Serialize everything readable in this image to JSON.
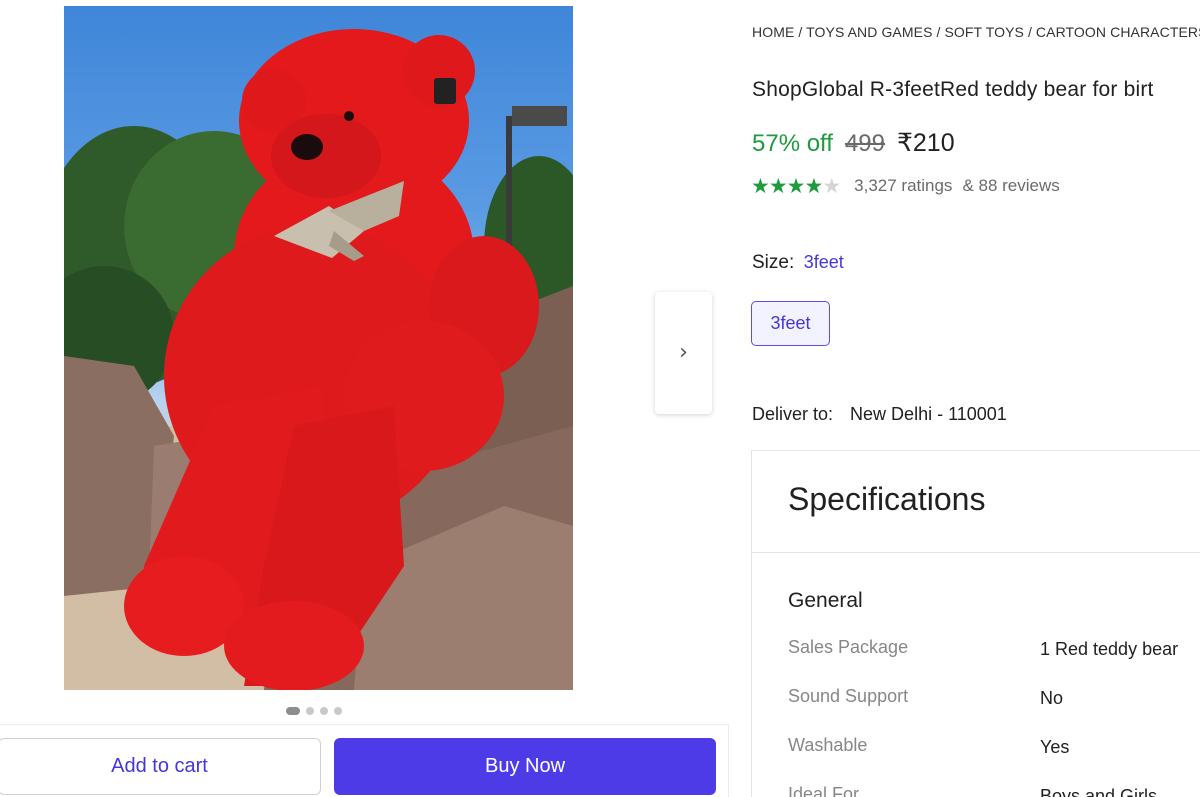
{
  "breadcrumb": "HOME / TOYS AND GAMES / SOFT TOYS / CARTOON CHARACTERS",
  "product": {
    "title": "ShopGlobal R-3feetRed teddy bear for birt",
    "discount": "57% off",
    "mrp": "499",
    "price": "₹210",
    "rating": {
      "stars": 4,
      "max_stars": 5
    },
    "ratings_count": "3,327 ratings",
    "reviews_count": "& 88 reviews"
  },
  "size": {
    "label": "Size:",
    "selected": "3feet",
    "options": [
      "3feet"
    ]
  },
  "delivery": {
    "label": "Deliver to:",
    "location": "New Delhi - 110001"
  },
  "specifications": {
    "title": "Specifications",
    "group": "General",
    "rows": [
      {
        "key": "Sales Package",
        "value": "1 Red teddy bear"
      },
      {
        "key": "Sound Support",
        "value": "No"
      },
      {
        "key": "Washable",
        "value": "Yes"
      },
      {
        "key": "Ideal For",
        "value": "Boys and Girls"
      }
    ]
  },
  "gallery": {
    "image_count": 4,
    "active_index": 0,
    "next_icon": "chevron-right-icon"
  },
  "actions": {
    "add_to_cart": "Add to cart",
    "buy_now": "Buy Now"
  },
  "colors": {
    "accent": "#4d3be8",
    "discount_green": "#1c9c3c",
    "product_red": "#e3191c"
  }
}
